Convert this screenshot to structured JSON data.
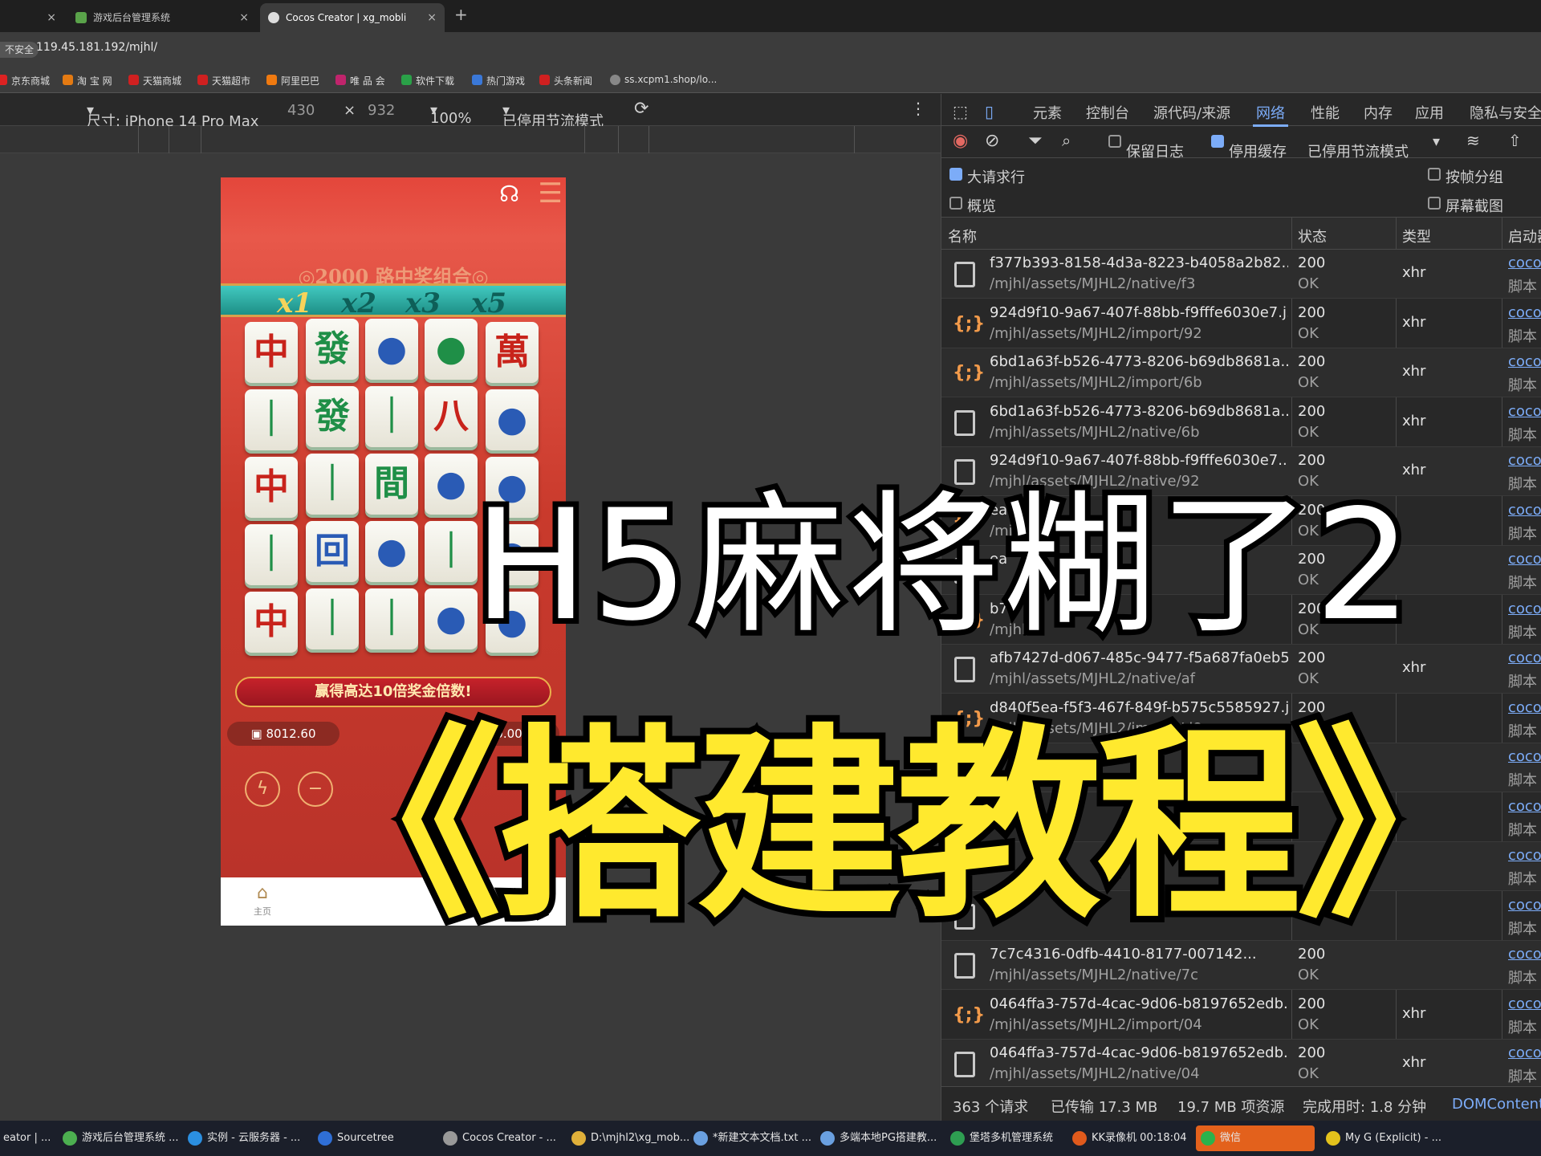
{
  "browser": {
    "tabs": [
      {
        "label": "",
        "icon": "tab-icon"
      },
      {
        "label": "游戏后台管理系统",
        "icon": "game-admin-icon"
      },
      {
        "label": "Cocos Creator | xg_mobli",
        "icon": "cocos-icon"
      }
    ],
    "insecure_label": "不安全",
    "url": "119.45.181.192/mjhl/",
    "bookmarks": [
      "京东商城",
      "淘 宝 网",
      "天猫商城",
      "天猫超市",
      "阿里巴巴",
      "唯 品 会",
      "软件下载",
      "热门游戏",
      "头条新闻",
      "ss.xcpm1.shop/lo..."
    ]
  },
  "device_toolbar": {
    "size_label": "尺寸: iPhone 14 Pro Max",
    "width": "430",
    "times": "×",
    "height": "932",
    "zoom": "100%",
    "throttle": "已停用节流模式"
  },
  "game": {
    "title": "◎2000 路中奖组合◎",
    "multipliers": [
      "x1",
      "x2",
      "x3",
      "x5"
    ],
    "reels": [
      [
        "中",
        "｜",
        "中",
        "｜",
        "中"
      ],
      [
        "發",
        "發",
        "｜",
        "回",
        "｜"
      ],
      [
        "●",
        "｜",
        "間",
        "●",
        "｜"
      ],
      [
        "●",
        "八",
        "●",
        "｜",
        "●"
      ],
      [
        "萬",
        "●",
        "●",
        "●",
        "●"
      ]
    ],
    "banner": "赢得高达10倍奖金倍数!",
    "balance": "8012.60",
    "win": "0.00",
    "ctrl_left": "ϟ",
    "ctrl_minus": "−",
    "nav_home": "主页",
    "nav_home_icon": "⌂",
    "nav_second_icon": "◈"
  },
  "devtools": {
    "tabs": [
      "元素",
      "控制台",
      "源代码/来源",
      "网络",
      "性能",
      "内存",
      "应用",
      "隐私与安全"
    ],
    "active_tab": "网络",
    "toolbar": {
      "preserve_log": "保留日志",
      "disable_cache": "停用缓存",
      "throttle": "已停用节流模式"
    },
    "options": {
      "big_rows": "大请求行",
      "overview": "概览",
      "group_by_frame": "按帧分组",
      "screenshots": "屏幕截图"
    },
    "columns": {
      "name": "名称",
      "status": "状态",
      "type": "类型",
      "initiator": "启动器"
    },
    "rows": [
      {
        "n1": "f377b393-8158-4d3a-8223-b4058a2b82...",
        "n2": "/mjhl/assets/MJHL2/native/f3",
        "st": "200",
        "st2": "OK",
        "ty": "xhr",
        "in1": "coco",
        "in2": "脚本",
        "icon": "doc"
      },
      {
        "n1": "924d9f10-9a67-407f-88bb-f9fffe6030e7.j...",
        "n2": "/mjhl/assets/MJHL2/import/92",
        "st": "200",
        "st2": "OK",
        "ty": "xhr",
        "in1": "coco",
        "in2": "脚本",
        "icon": "js"
      },
      {
        "n1": "6bd1a63f-b526-4773-8206-b69db8681a...",
        "n2": "/mjhl/assets/MJHL2/import/6b",
        "st": "200",
        "st2": "OK",
        "ty": "xhr",
        "in1": "coco",
        "in2": "脚本",
        "icon": "js"
      },
      {
        "n1": "6bd1a63f-b526-4773-8206-b69db8681a...",
        "n2": "/mjhl/assets/MJHL2/native/6b",
        "st": "200",
        "st2": "OK",
        "ty": "xhr",
        "in1": "coco",
        "in2": "脚本",
        "icon": "doc"
      },
      {
        "n1": "924d9f10-9a67-407f-88bb-f9fffe6030e7....",
        "n2": "/mjhl/assets/MJHL2/native/92",
        "st": "200",
        "st2": "OK",
        "ty": "xhr",
        "in1": "coco",
        "in2": "脚本",
        "icon": "doc"
      },
      {
        "n1": "ea",
        "n2": "/mjhl/",
        "st": "200",
        "st2": "OK",
        "ty": "",
        "in1": "coco",
        "in2": "脚本",
        "icon": "js"
      },
      {
        "n1": "ea",
        "n2": "",
        "st": "200",
        "st2": "OK",
        "ty": "",
        "in1": "coco",
        "in2": "脚本",
        "icon": "doc"
      },
      {
        "n1": "b7",
        "n2": "/mjhl/a",
        "st": "200",
        "st2": "OK",
        "ty": "",
        "in1": "coco",
        "in2": "脚本",
        "icon": "js"
      },
      {
        "n1": "afb7427d-d067-485c-9477-f5a687fa0eb5...",
        "n2": "/mjhl/assets/MJHL2/native/af",
        "st": "200",
        "st2": "OK",
        "ty": "xhr",
        "in1": "coco",
        "in2": "脚本",
        "icon": "doc"
      },
      {
        "n1": "d840f5ea-f5f3-467f-849f-b575c5585927.j...",
        "n2": "/mjhl/assets/MJHL2/import/d8",
        "st": "200",
        "st2": "OK",
        "ty": "",
        "in1": "coco",
        "in2": "脚本",
        "icon": "js"
      },
      {
        "n1": "",
        "n2": "",
        "st": "",
        "st2": "",
        "ty": "",
        "in1": "coco",
        "in2": "脚本",
        "icon": "doc"
      },
      {
        "n1": "",
        "n2": "",
        "st": "",
        "st2": "",
        "ty": "",
        "in1": "coco",
        "in2": "脚本",
        "icon": "doc"
      },
      {
        "n1": "",
        "n2": "",
        "st": "",
        "st2": "",
        "ty": "",
        "in1": "coco",
        "in2": "脚本",
        "icon": "js"
      },
      {
        "n1": "",
        "n2": "",
        "st": "",
        "st2": "",
        "ty": "",
        "in1": "coco",
        "in2": "脚本",
        "icon": "doc"
      },
      {
        "n1": "7c7c4316-0dfb-4410-8177-007142...",
        "n2": "/mjhl/assets/MJHL2/native/7c",
        "st": "200",
        "st2": "OK",
        "ty": "",
        "in1": "coco",
        "in2": "脚本",
        "icon": "doc"
      },
      {
        "n1": "0464ffa3-757d-4cac-9d06-b8197652edb...",
        "n2": "/mjhl/assets/MJHL2/import/04",
        "st": "200",
        "st2": "OK",
        "ty": "xhr",
        "in1": "coco",
        "in2": "脚本",
        "icon": "js"
      },
      {
        "n1": "0464ffa3-757d-4cac-9d06-b8197652edb...",
        "n2": "/mjhl/assets/MJHL2/native/04",
        "st": "200",
        "st2": "OK",
        "ty": "xhr",
        "in1": "coco",
        "in2": "脚本",
        "icon": "doc"
      }
    ],
    "status": {
      "requests": "363 个请求",
      "transferred": "已传输 17.3 MB",
      "resources": "19.7 MB 项资源",
      "finish": "完成用时: 1.8 分钟",
      "dom": "DOMContent"
    }
  },
  "overlay": {
    "line1": "H5麻将糊了2",
    "line2": "《搭建教程》"
  },
  "taskbar": [
    "eator | ...",
    "游戏后台管理系统 ...",
    "实例 - 云服务器 - ...",
    "Sourcetree",
    "Cocos Creator - ...",
    "D:\\mjhl2\\xg_mob...",
    "*新建文本文档.txt ...",
    "多端本地PG搭建教...",
    "堡塔多机管理系统",
    "KK录像机 00:18:04",
    "微信",
    "My G (Explicit) - ..."
  ],
  "colors": {
    "accent": "#7cacf8",
    "overlay_yellow": "#ffe92e",
    "task_active": "#e3611c"
  }
}
